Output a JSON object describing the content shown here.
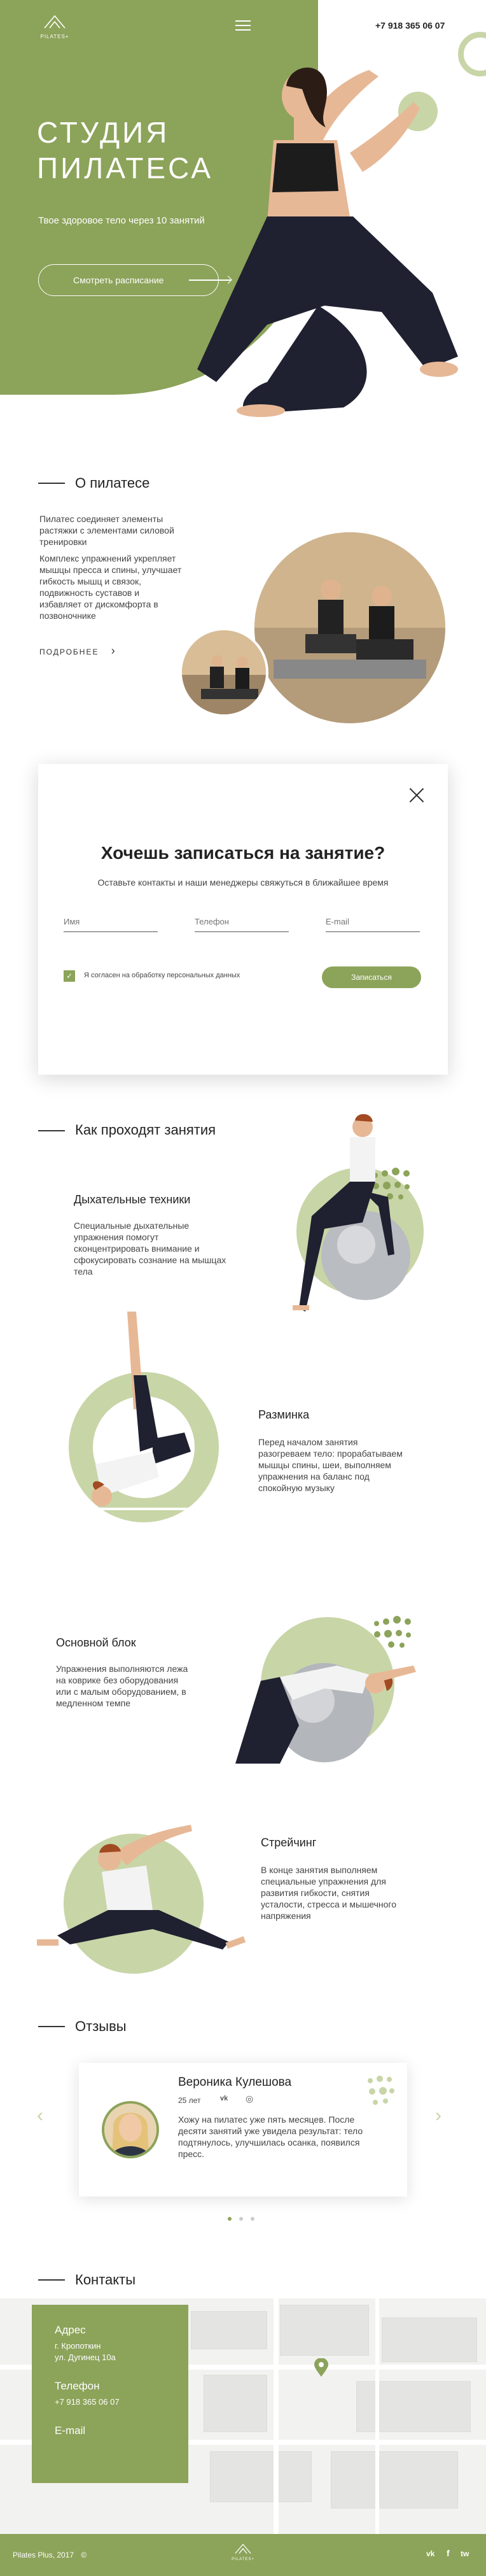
{
  "header": {
    "logo_text": "PILATES+",
    "phone": "+7 918 365 06 07"
  },
  "hero": {
    "title_line1": "СТУДИЯ",
    "title_line2": "ПИЛАТЕСА",
    "subtitle": "Твое здоровое тело через 10 занятий",
    "button_label": "Смотреть расписание"
  },
  "about": {
    "title": "О пилатесе",
    "paragraph1": "Пилатес соединяет элементы растяжки с элементами силовой тренировки",
    "paragraph2": "Комплекс упражнений укрепляет мышцы пресса и спины, улучшает гибкость мышц и связок, подвижность суставов и избавляет от дискомфорта в позвоночнике",
    "more_label": "ПОДРОБНЕЕ",
    "more_arrow": "›"
  },
  "form": {
    "title": "Хочешь записаться на занятие?",
    "subtitle": "Оставьте контакты и наши менеджеры свяжуться в ближайшее время",
    "name_placeholder": "Имя",
    "phone_placeholder": "Телефон",
    "email_placeholder": "E-mail",
    "consent_label": "Я согласен на обработку персональных данных",
    "submit_label": "Записаться",
    "check_mark": "✓"
  },
  "process": {
    "title": "Как проходят занятия",
    "steps": [
      {
        "title": "Дыхательные техники",
        "text": "Специальные дыхательные упражнения помогут сконцентрировать внимание и сфокусировать сознание на мышцах тела"
      },
      {
        "title": "Разминка",
        "text": "Перед началом занятия разогреваем тело: прорабатываем мышцы спины, шеи, выполняем упражнения на баланс под спокойную музыку"
      },
      {
        "title": "Основной блок",
        "text": "Упражнения выполняются лежа на коврике без оборудования или с малым оборудованием, в медленном темпе"
      },
      {
        "title": "Стрейчинг",
        "text": "В конце занятия выполняем специальные упражнения для развития гибкости, снятия усталости, стресса и мышечного напряжения"
      }
    ]
  },
  "reviews": {
    "title": "Отзывы",
    "items": [
      {
        "name": "Вероника Кулешова",
        "age": "25 лет",
        "text": "Хожу на пилатес уже пять месяцев. После десяти занятий уже увидела результат: тело подтянулось, улучшилась осанка, появился пресс."
      }
    ],
    "prev_arrow": "‹",
    "next_arrow": "›",
    "social_vk": "vk",
    "social_ig": "◎"
  },
  "contacts": {
    "title": "Контакты",
    "address_label": "Адрес",
    "address_line1": "г. Кропоткин",
    "address_line2": "ул. Дугинец 10а",
    "phone_label": "Телефон",
    "phone_value": "+7 918 365 06 07",
    "email_label": "E-mail"
  },
  "footer": {
    "copyright": "Pilates Plus, 2017",
    "copyright_symbol": "©",
    "logo_text": "PILATES+",
    "social": [
      "vk",
      "f",
      "tw"
    ]
  },
  "colors": {
    "accent": "#8ca35a",
    "accent_light": "#c8d5a7",
    "text": "#333333"
  },
  "icons": [
    "logo-icon",
    "menu-icon",
    "arrow-right-icon",
    "close-icon",
    "check-icon",
    "chevron-left-icon",
    "chevron-right-icon",
    "vk-icon",
    "instagram-icon",
    "facebook-icon",
    "twitter-icon",
    "map-pin-icon",
    "copyright-icon"
  ]
}
